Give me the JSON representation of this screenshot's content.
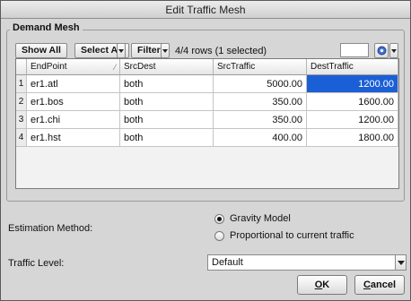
{
  "window": {
    "title": "Edit Traffic Mesh"
  },
  "demand_mesh": {
    "group_title": "Demand Mesh",
    "toolbar": {
      "show_all_label": "Show All",
      "select_all_label": "Select All",
      "filter_label": "Filter",
      "row_count_text": "4/4 rows (1 selected)",
      "search_value": ""
    },
    "table": {
      "columns": [
        "EndPoint",
        "SrcDest",
        "SrcTraffic",
        "DestTraffic"
      ],
      "rows": [
        {
          "num": "1",
          "endpoint": "er1.atl",
          "srcdest": "both",
          "srctraffic": "5000.00",
          "desttraffic": "1200.00",
          "selected_col": "desttraffic"
        },
        {
          "num": "2",
          "endpoint": "er1.bos",
          "srcdest": "both",
          "srctraffic": "350.00",
          "desttraffic": "1600.00"
        },
        {
          "num": "3",
          "endpoint": "er1.chi",
          "srcdest": "both",
          "srctraffic": "350.00",
          "desttraffic": "1200.00"
        },
        {
          "num": "4",
          "endpoint": "er1.hst",
          "srcdest": "both",
          "srctraffic": "400.00",
          "desttraffic": "1800.00"
        }
      ]
    }
  },
  "estimation": {
    "label": "Estimation Method:",
    "options": [
      {
        "label": "Gravity Model",
        "selected": true
      },
      {
        "label": "Proportional to current traffic",
        "selected": false
      }
    ]
  },
  "traffic_level": {
    "label": "Traffic Level:",
    "value": "Default"
  },
  "buttons": {
    "ok_first": "O",
    "ok_rest": "K",
    "cancel_first": "C",
    "cancel_rest": "ancel"
  },
  "colors": {
    "selection": "#1b5fd6",
    "dialog_bg": "#d6d6d6"
  },
  "icons": {
    "gear": "gear-icon",
    "dropdown": "chevron-down-icon"
  }
}
